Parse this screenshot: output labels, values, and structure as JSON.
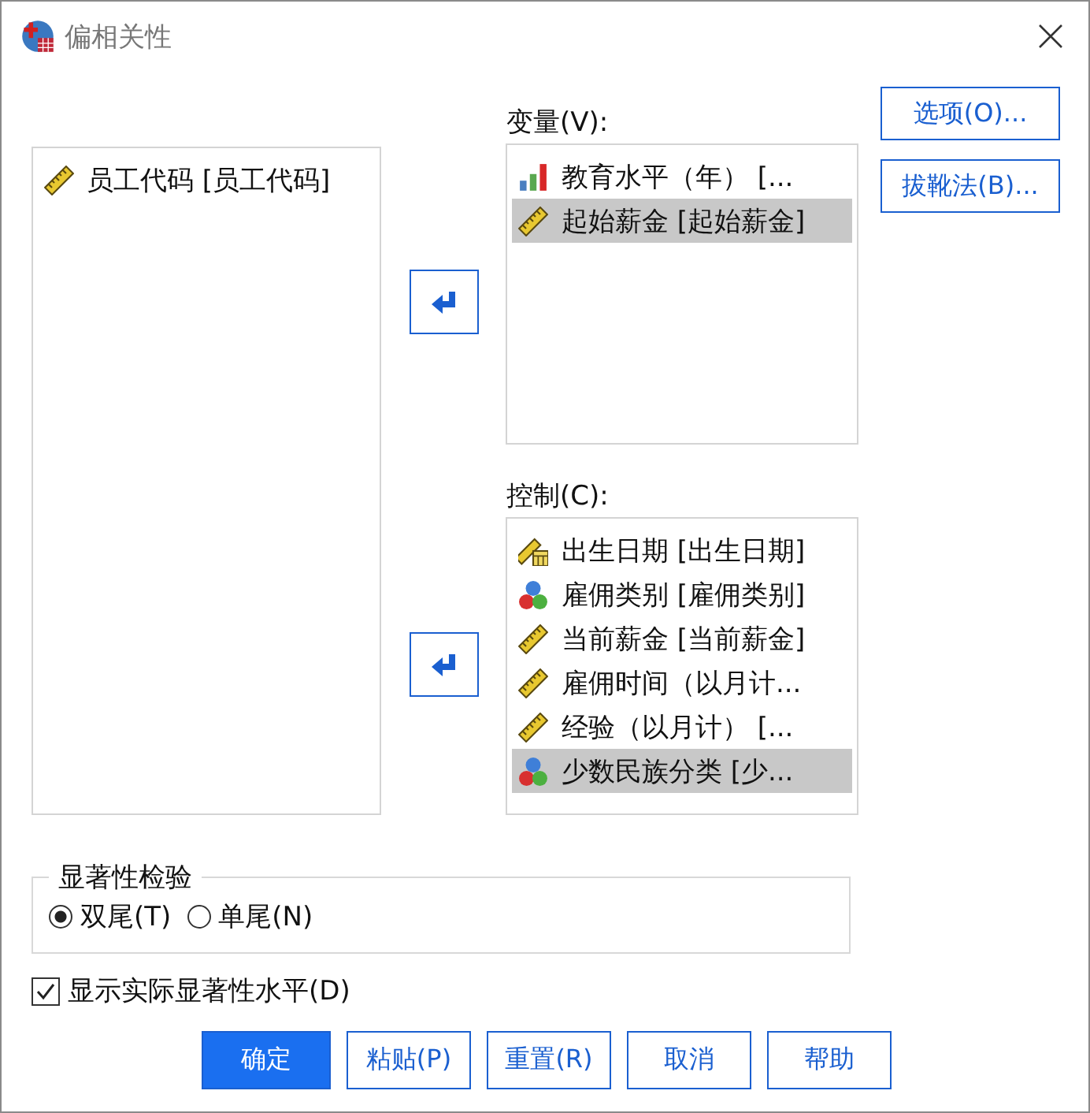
{
  "window": {
    "title": "偏相关性"
  },
  "source_list": {
    "items": [
      {
        "label": "员工代码 [员工代码]",
        "kind": "scale",
        "selected": false
      }
    ]
  },
  "variables": {
    "label": "变量(V):",
    "items": [
      {
        "label": "教育水平（年） [...",
        "kind": "ordinal",
        "selected": false
      },
      {
        "label": "起始薪金 [起始薪金]",
        "kind": "scale",
        "selected": true
      }
    ]
  },
  "controls": {
    "label": "控制(C):",
    "items": [
      {
        "label": "出生日期 [出生日期]",
        "kind": "date",
        "selected": false
      },
      {
        "label": "雇佣类别 [雇佣类别]",
        "kind": "nominal",
        "selected": false
      },
      {
        "label": "当前薪金 [当前薪金]",
        "kind": "scale",
        "selected": false
      },
      {
        "label": "雇佣时间（以月计...",
        "kind": "scale",
        "selected": false
      },
      {
        "label": "经验（以月计） [...",
        "kind": "scale",
        "selected": false
      },
      {
        "label": "少数民族分类 [少...",
        "kind": "nominal",
        "selected": true
      }
    ]
  },
  "side_buttons": [
    "选项(O)...",
    "拔靴法(B)..."
  ],
  "significance": {
    "title": "显著性检验",
    "options": [
      {
        "label": "双尾(T)",
        "selected": true
      },
      {
        "label": "单尾(N)",
        "selected": false
      }
    ]
  },
  "show_significance": {
    "label": "显示实际显著性水平(D)",
    "checked": true
  },
  "buttons": [
    {
      "label": "确定",
      "primary": true
    },
    {
      "label": "粘贴(P)",
      "primary": false
    },
    {
      "label": "重置(R)",
      "primary": false
    },
    {
      "label": "取消",
      "primary": false
    },
    {
      "label": "帮助",
      "primary": false
    }
  ]
}
